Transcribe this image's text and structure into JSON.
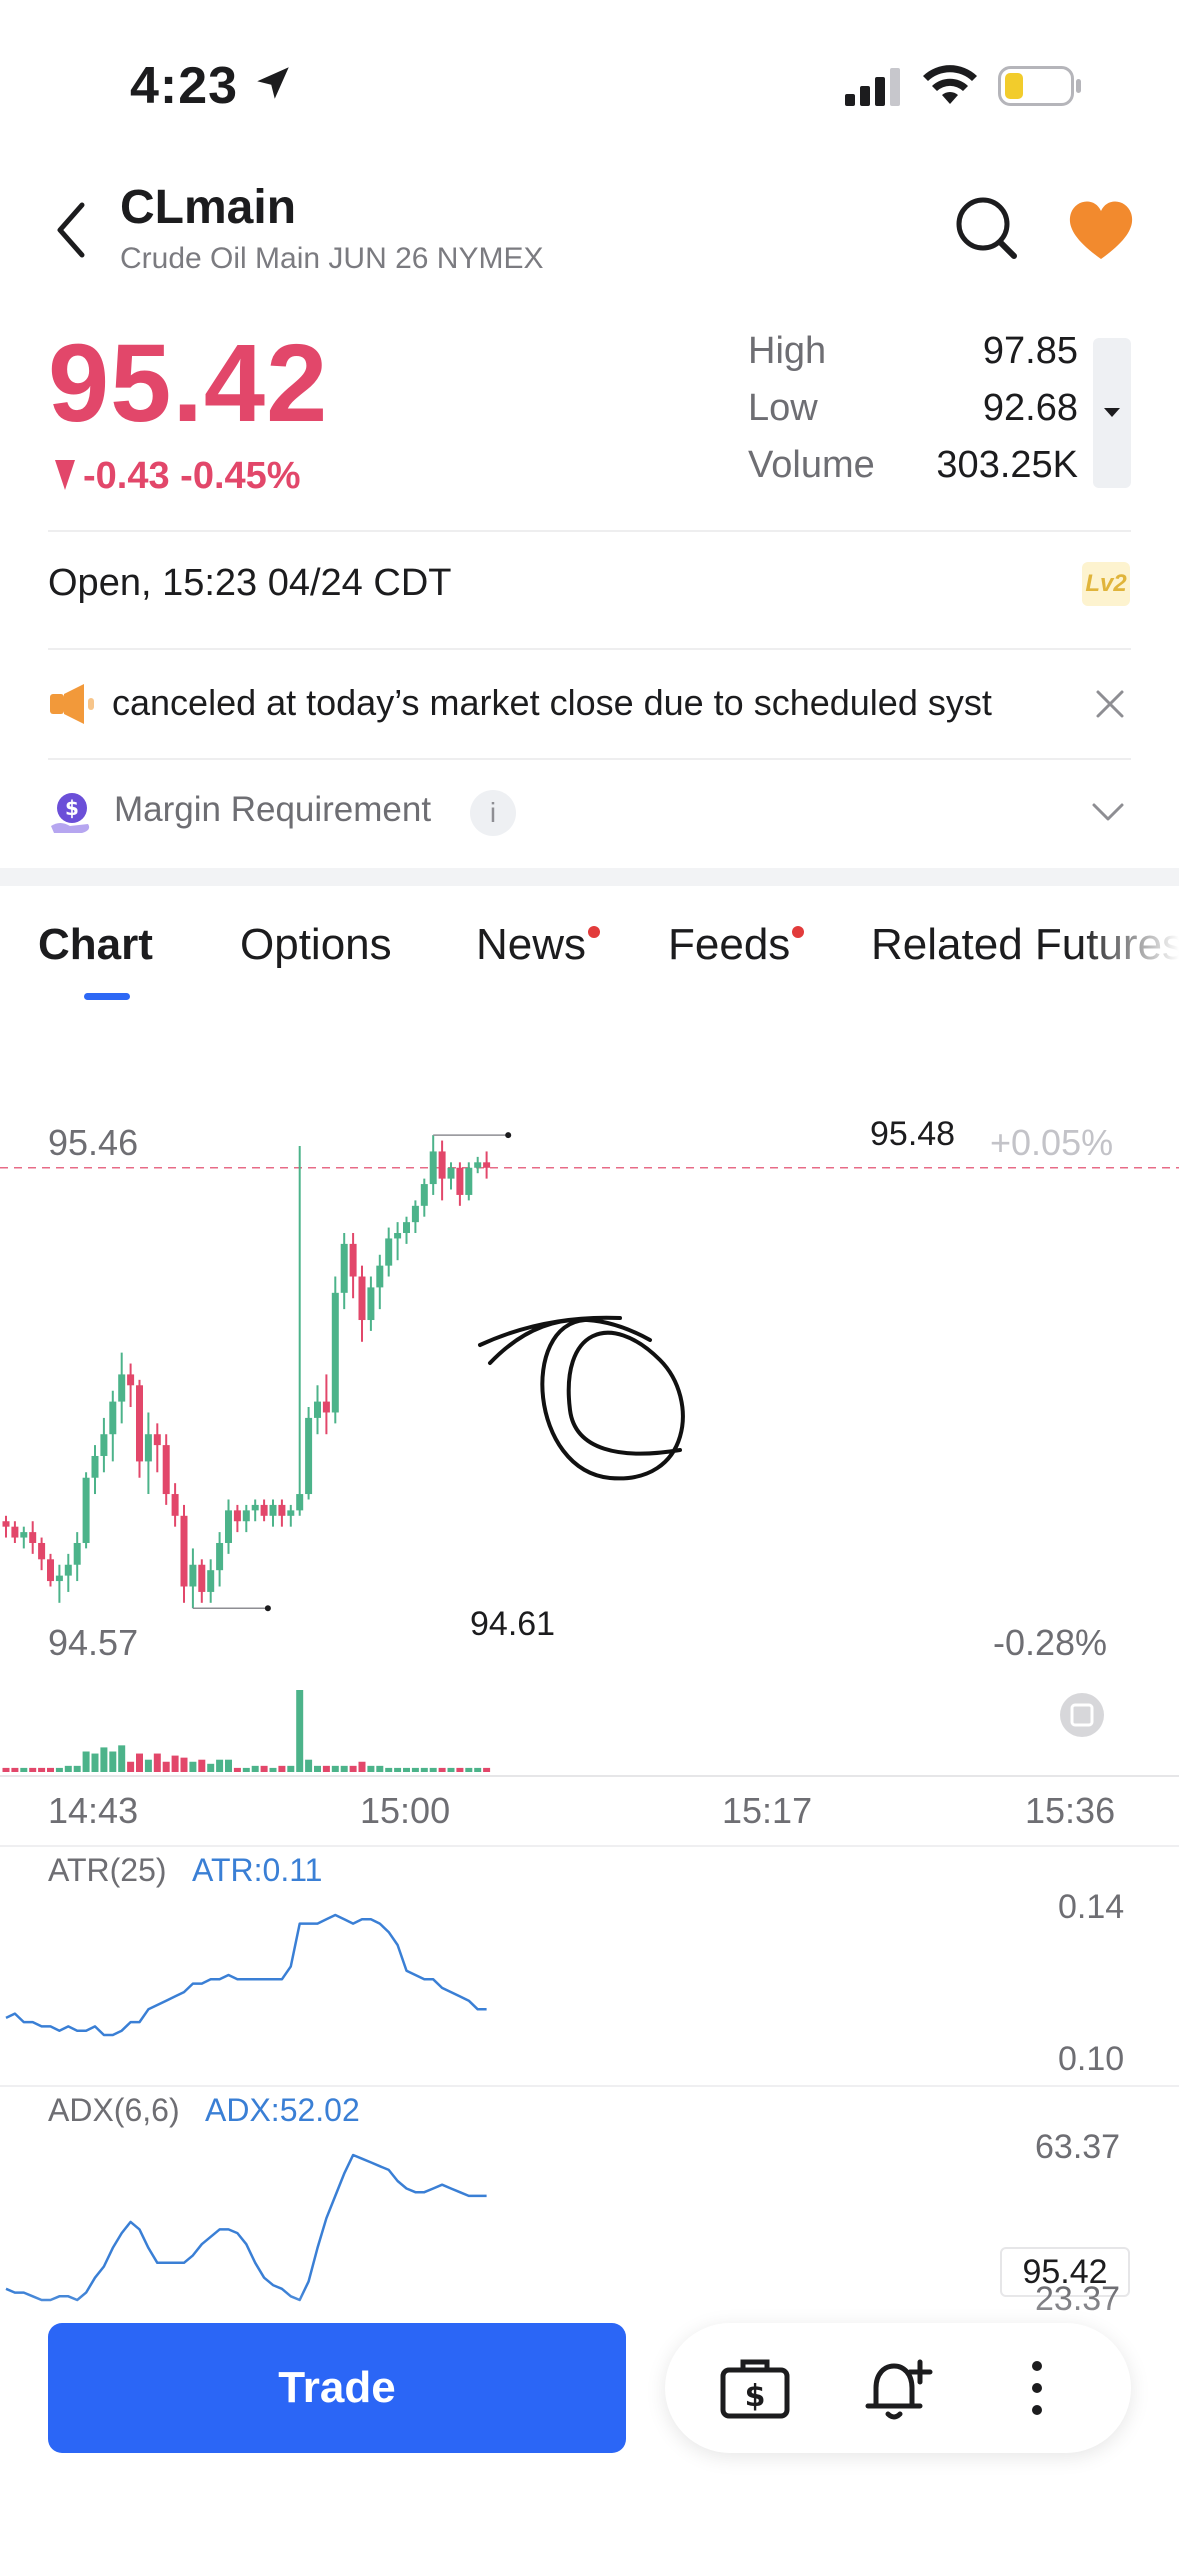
{
  "status_bar": {
    "time": "4:23"
  },
  "header": {
    "title": "CLmain",
    "subtitle": "Crude Oil Main JUN 26 NYMEX"
  },
  "quote": {
    "price": "95.42",
    "change": "-0.43 -0.45%",
    "stats": [
      {
        "label": "High",
        "value": "97.85"
      },
      {
        "label": "Low",
        "value": "92.68"
      },
      {
        "label": "Volume",
        "value": "303.25K"
      }
    ]
  },
  "session": {
    "text": "Open, 15:23 04/24 CDT",
    "badge": "Lv2"
  },
  "notice": {
    "text": "canceled at today’s market close due to scheduled syst"
  },
  "margin": {
    "label": "Margin Requirement",
    "info": "i"
  },
  "tabs": [
    {
      "label": "Chart",
      "active": true
    },
    {
      "label": "Options"
    },
    {
      "label": "News",
      "dot": true
    },
    {
      "label": "Feeds",
      "dot": true
    },
    {
      "label": "Related Futures"
    }
  ],
  "chart": {
    "y_top": "95.46",
    "y_bottom": "94.57",
    "pct_top": "+0.05%",
    "pct_bottom": "-0.28%",
    "last_price": "95.42",
    "high_marker": "95.48",
    "low_marker": "94.61",
    "x_ticks": [
      "14:43",
      "15:00",
      "15:17",
      "15:36"
    ],
    "atr": {
      "name": "ATR(25)",
      "value": "ATR:0.11",
      "max": "0.14",
      "min": "0.10"
    },
    "adx": {
      "name": "ADX(6,6)",
      "value": "ADX:52.02",
      "max": "63.37",
      "min": "23.37"
    }
  },
  "colors": {
    "up": "#4cb38a",
    "down": "#e2476a",
    "accent": "#2b66f6",
    "line": "#3a7fd5"
  },
  "actions": {
    "trade": "Trade"
  },
  "chart_data": {
    "type": "candlestick",
    "ylim": [
      94.57,
      95.46
    ],
    "x_ticks": [
      "14:43",
      "15:00",
      "15:17",
      "15:36"
    ],
    "candles": [
      [
        94.77,
        94.78,
        94.74,
        94.76
      ],
      [
        94.76,
        94.77,
        94.73,
        94.74
      ],
      [
        94.74,
        94.76,
        94.72,
        94.75
      ],
      [
        94.75,
        94.77,
        94.71,
        94.73
      ],
      [
        94.73,
        94.74,
        94.68,
        94.7
      ],
      [
        94.7,
        94.71,
        94.65,
        94.66
      ],
      [
        94.66,
        94.69,
        94.62,
        94.67
      ],
      [
        94.67,
        94.71,
        94.64,
        94.69
      ],
      [
        94.69,
        94.75,
        94.66,
        94.73
      ],
      [
        94.73,
        94.86,
        94.72,
        94.85
      ],
      [
        94.85,
        94.91,
        94.82,
        94.89
      ],
      [
        94.89,
        94.96,
        94.86,
        94.93
      ],
      [
        94.93,
        95.01,
        94.88,
        94.99
      ],
      [
        94.99,
        95.08,
        94.95,
        95.04
      ],
      [
        95.04,
        95.06,
        94.98,
        95.02
      ],
      [
        95.02,
        95.03,
        94.85,
        94.88
      ],
      [
        94.88,
        94.97,
        94.82,
        94.93
      ],
      [
        94.93,
        94.95,
        94.86,
        94.91
      ],
      [
        94.91,
        94.93,
        94.8,
        94.82
      ],
      [
        94.82,
        94.84,
        94.76,
        94.78
      ],
      [
        94.78,
        94.8,
        94.62,
        94.65
      ],
      [
        94.65,
        94.72,
        94.61,
        94.69
      ],
      [
        94.69,
        94.7,
        94.62,
        94.64
      ],
      [
        94.64,
        94.7,
        94.62,
        94.68
      ],
      [
        94.68,
        94.75,
        94.65,
        94.73
      ],
      [
        94.73,
        94.81,
        94.71,
        94.79
      ],
      [
        94.79,
        94.8,
        94.75,
        94.77
      ],
      [
        94.77,
        94.8,
        94.75,
        94.79
      ],
      [
        94.79,
        94.81,
        94.77,
        94.8
      ],
      [
        94.8,
        94.81,
        94.77,
        94.78
      ],
      [
        94.78,
        94.81,
        94.76,
        94.8
      ],
      [
        94.8,
        94.81,
        94.76,
        94.78
      ],
      [
        94.78,
        94.8,
        94.76,
        94.79
      ],
      [
        94.79,
        95.46,
        94.78,
        94.82
      ],
      [
        94.82,
        94.98,
        94.81,
        94.96
      ],
      [
        94.96,
        95.02,
        94.93,
        94.99
      ],
      [
        94.99,
        95.04,
        94.93,
        94.97
      ],
      [
        94.97,
        95.22,
        94.95,
        95.19
      ],
      [
        95.19,
        95.3,
        95.16,
        95.28
      ],
      [
        95.28,
        95.3,
        95.18,
        95.22
      ],
      [
        95.22,
        95.24,
        95.1,
        95.14
      ],
      [
        95.14,
        95.22,
        95.12,
        95.2
      ],
      [
        95.2,
        95.26,
        95.16,
        95.24
      ],
      [
        95.24,
        95.31,
        95.22,
        95.29
      ],
      [
        95.29,
        95.32,
        95.25,
        95.3
      ],
      [
        95.3,
        95.33,
        95.28,
        95.32
      ],
      [
        95.32,
        95.36,
        95.3,
        95.35
      ],
      [
        95.35,
        95.4,
        95.33,
        95.39
      ],
      [
        95.39,
        95.48,
        95.37,
        95.45
      ],
      [
        95.45,
        95.47,
        95.36,
        95.4
      ],
      [
        95.4,
        95.43,
        95.38,
        95.42
      ],
      [
        95.42,
        95.43,
        95.35,
        95.37
      ],
      [
        95.37,
        95.43,
        95.36,
        95.42
      ],
      [
        95.42,
        95.44,
        95.41,
        95.43
      ],
      [
        95.43,
        95.45,
        95.4,
        95.42
      ]
    ],
    "volume": [
      2,
      2,
      2,
      2,
      2,
      2,
      2,
      3,
      3,
      10,
      9,
      12,
      10,
      13,
      5,
      9,
      6,
      9,
      5,
      8,
      7,
      5,
      6,
      4,
      6,
      6,
      2,
      2,
      3,
      3,
      2,
      3,
      3,
      40,
      6,
      3,
      3,
      3,
      3,
      3,
      5,
      3,
      3,
      2,
      2,
      2,
      2,
      2,
      2,
      2,
      2,
      2,
      2,
      2,
      2
    ],
    "atr": [
      0.108,
      0.109,
      0.107,
      0.107,
      0.106,
      0.106,
      0.105,
      0.106,
      0.105,
      0.105,
      0.106,
      0.104,
      0.104,
      0.105,
      0.107,
      0.107,
      0.11,
      0.111,
      0.112,
      0.113,
      0.114,
      0.116,
      0.116,
      0.117,
      0.117,
      0.118,
      0.117,
      0.117,
      0.117,
      0.117,
      0.117,
      0.117,
      0.12,
      0.13,
      0.13,
      0.13,
      0.131,
      0.132,
      0.131,
      0.13,
      0.131,
      0.131,
      0.13,
      0.128,
      0.125,
      0.119,
      0.118,
      0.117,
      0.117,
      0.115,
      0.114,
      0.113,
      0.112,
      0.11,
      0.11
    ],
    "adx": [
      27,
      26,
      26,
      25,
      24,
      24,
      25,
      25,
      24,
      26,
      30,
      33,
      38,
      42,
      45,
      43,
      38,
      34,
      34,
      34,
      34,
      36,
      39,
      41,
      43,
      43,
      42,
      39,
      34,
      30,
      28,
      27,
      25,
      24,
      29,
      38,
      46,
      52,
      58,
      63,
      62,
      61,
      60,
      59,
      56,
      54,
      53,
      53,
      54,
      55,
      54,
      53,
      52,
      52,
      52
    ]
  }
}
